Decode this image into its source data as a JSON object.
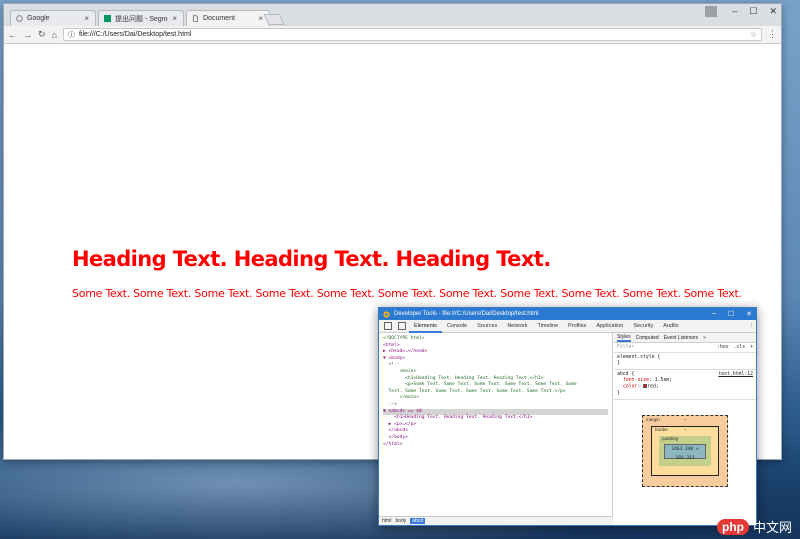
{
  "browser": {
    "tabs": [
      {
        "label": "Google",
        "icon": "google-icon"
      },
      {
        "label": "提出问题 - SegmentFa",
        "icon": "segmentfault-icon"
      },
      {
        "label": "Document",
        "icon": "document-icon"
      }
    ],
    "url": "file:///C:/Users/Dai/Desktop/test.html"
  },
  "page": {
    "heading": "Heading Text. Heading Text. Heading Text.",
    "paragraph": "Some Text. Some Text. Some Text. Some Text. Some Text. Some Text. Some Text. Some Text. Some Text. Some Text. Some Text.",
    "text_color": "#ff0000"
  },
  "devtools": {
    "title": "Developer Tools - file:///C:/Users/Dai/Desktop/test.html",
    "tabs": [
      "Elements",
      "Console",
      "Sources",
      "Network",
      "Timeline",
      "Profiles",
      "Application",
      "Security",
      "Audits"
    ],
    "dom_lines": [
      {
        "text": "<!DOCTYPE html>",
        "cls": "cm"
      },
      {
        "text": "<html>",
        "cls": ""
      },
      {
        "text": "▶ <head>…</head>",
        "cls": ""
      },
      {
        "text": "▼ <body>",
        "cls": ""
      },
      {
        "text": "  <!--",
        "cls": "cm"
      },
      {
        "text": "      <main>",
        "cls": "cm"
      },
      {
        "text": "        <h1>Heading Text. Heading Text. Heading Text.</h1>",
        "cls": "cm"
      },
      {
        "text": "        <p>Some Text. Some Text. Some Text. Some Text. Some Text. Some",
        "cls": "cm"
      },
      {
        "text": "  Text. Some Text. Some Text. Some Text. Some Text. Some Text.</p>",
        "cls": "cm"
      },
      {
        "text": "      </main>",
        "cls": "cm"
      },
      {
        "text": "  -->",
        "cls": "cm"
      },
      {
        "text": "▼ <abcd> == $0",
        "cls": "sel"
      },
      {
        "text": "    <h1>Heading Text. Heading Text. Heading Text.</h1>",
        "cls": ""
      },
      {
        "text": "  ▶ <p>…</p>",
        "cls": ""
      },
      {
        "text": "  </abcd>",
        "cls": ""
      },
      {
        "text": "  </body>",
        "cls": ""
      },
      {
        "text": "</html>",
        "cls": ""
      }
    ],
    "breadcrumb": [
      "html",
      "body",
      "abcd"
    ],
    "styles": {
      "tabs": [
        "Styles",
        "Computed",
        "Event Listeners"
      ],
      "filter_placeholder": "Filter",
      "hov": ":hov",
      "cls": ".cls",
      "element_style": "element.style {",
      "rule_selector": "abcd {",
      "rule_source": "test.html:12",
      "props": [
        {
          "name": "font-size",
          "value": "1.5em;"
        },
        {
          "name": "color",
          "value": "red;"
        }
      ]
    },
    "boxmodel": {
      "margin": "margin",
      "border": "border",
      "padding": "padding",
      "content": "1463.340 × 183.313",
      "dash": "–"
    }
  },
  "watermark": {
    "badge": "php",
    "text": "中文网"
  }
}
